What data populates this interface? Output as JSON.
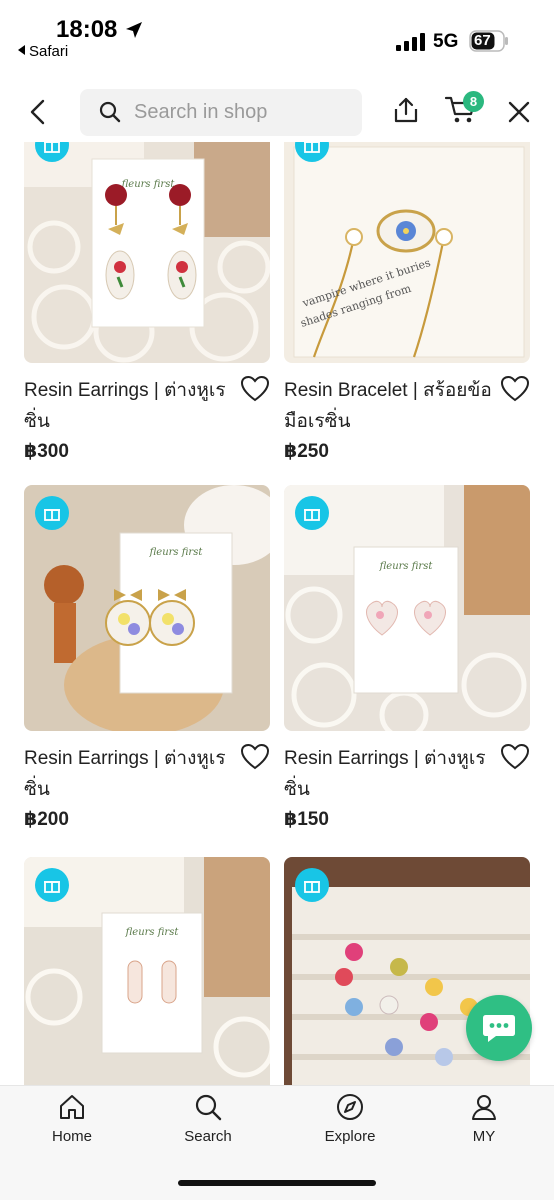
{
  "status_bar": {
    "time": "18:08",
    "back_app": "Safari",
    "network": "5G",
    "battery": "67"
  },
  "header": {
    "search_placeholder": "Search in shop",
    "cart_count": "8"
  },
  "products": [
    {
      "title": "Resin Earrings | ต่างหูเรซิ่น",
      "price": "฿300",
      "image": "red-rose-teardrop-earrings"
    },
    {
      "title": "Resin Bracelet  | สร้อยข้อมือเรซิ่น",
      "price": "฿250",
      "image": "blue-flower-bracelet"
    },
    {
      "title": "Resin Earrings | ต่างหูเรซิ่น",
      "price": "฿200",
      "image": "bow-circle-earrings"
    },
    {
      "title": "Resin Earrings | ต่างหูเรซิ่น",
      "price": "฿150",
      "image": "heart-stud-earrings"
    },
    {
      "title": "",
      "price": "",
      "image": "capsule-earrings"
    },
    {
      "title": "",
      "price": "",
      "image": "resin-rings-tray"
    }
  ],
  "bottom_nav": [
    {
      "label": "Home",
      "icon": "home-icon"
    },
    {
      "label": "Search",
      "icon": "search-icon"
    },
    {
      "label": "Explore",
      "icon": "compass-icon"
    },
    {
      "label": "MY",
      "icon": "user-icon"
    }
  ],
  "colors": {
    "gift_badge": "#18c5e6",
    "cart_badge": "#2bb87f",
    "chat_button": "#2fbf84"
  }
}
